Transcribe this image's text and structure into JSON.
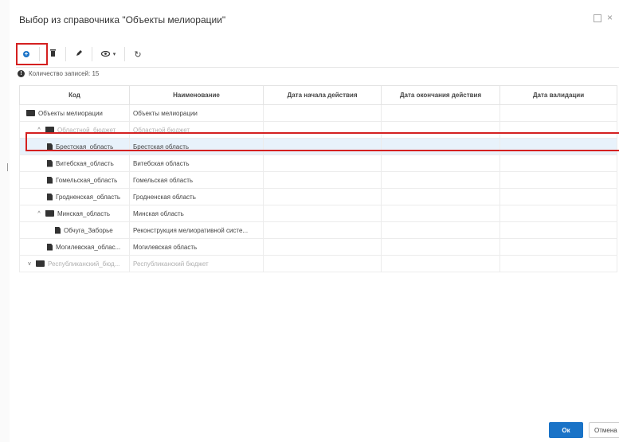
{
  "dialog": {
    "title": "Выбор из справочника \"Объекты мелиорации\"",
    "maximize_glyph": "□",
    "close_glyph": "×"
  },
  "toolbar": {
    "add_icon": "plus-circle-icon",
    "add_glyph": "+",
    "delete_icon": "trash-icon",
    "delete_glyph": "🗑",
    "edit_icon": "pencil-icon",
    "edit_glyph": "✎",
    "view_icon": "eye-icon",
    "view_glyph": "👁",
    "view_dropdown_glyph": "▾",
    "refresh_icon": "refresh-icon",
    "refresh_glyph": "↻"
  },
  "records": {
    "info_glyph": "!",
    "count_label": "Количество записей: 15"
  },
  "grid": {
    "columns": [
      "Код",
      "Наименование",
      "Дата начала действия",
      "Дата окончания действия",
      "Дата валидации"
    ],
    "rows": [
      {
        "indent": 0,
        "chevron": "",
        "icon": "folder-open-icon",
        "code": "Объекты мелиорации",
        "name": "Объекты мелиорации",
        "muted": false,
        "selected": false
      },
      {
        "indent": 1,
        "chevron": "^",
        "icon": "folder-open-icon",
        "code": "Областной_бюджет",
        "name": "Областной бюджет",
        "muted": true,
        "selected": false
      },
      {
        "indent": 2,
        "chevron": "",
        "icon": "file-icon",
        "code": "Брестская_область",
        "name": "Брестская область",
        "muted": false,
        "selected": true
      },
      {
        "indent": 2,
        "chevron": "",
        "icon": "file-icon",
        "code": "Витебская_область",
        "name": "Витебская область",
        "muted": false,
        "selected": false
      },
      {
        "indent": 2,
        "chevron": "",
        "icon": "file-icon",
        "code": "Гомельская_область",
        "name": "Гомельская область",
        "muted": false,
        "selected": false
      },
      {
        "indent": 2,
        "chevron": "",
        "icon": "file-icon",
        "code": "Гродненская_область",
        "name": "Гродненская область",
        "muted": false,
        "selected": false
      },
      {
        "indent": 1,
        "chevron": "^",
        "icon": "folder-open-icon",
        "code": "Минская_область",
        "name": "Минская область",
        "muted": false,
        "selected": false
      },
      {
        "indent": 3,
        "chevron": "",
        "icon": "file-icon",
        "code": "Обчуга_Заборье",
        "name": "Реконструкция мелиоративной систе...",
        "muted": false,
        "selected": false
      },
      {
        "indent": 2,
        "chevron": "",
        "icon": "file-icon",
        "code": "Могилевская_облас...",
        "name": "Могилевская область",
        "muted": false,
        "selected": false
      },
      {
        "indent": 0,
        "chevron": "v",
        "icon": "folder-icon",
        "code": "Республиканский_бюд...",
        "name": "Республиканский бюджет",
        "muted": true,
        "selected": false
      }
    ]
  },
  "footer": {
    "ok_label": "Ок",
    "cancel_label": "Отмена"
  },
  "colors": {
    "accent": "#1a73c7",
    "highlight": "#d42020",
    "selected_row": "#e8f2fb"
  }
}
